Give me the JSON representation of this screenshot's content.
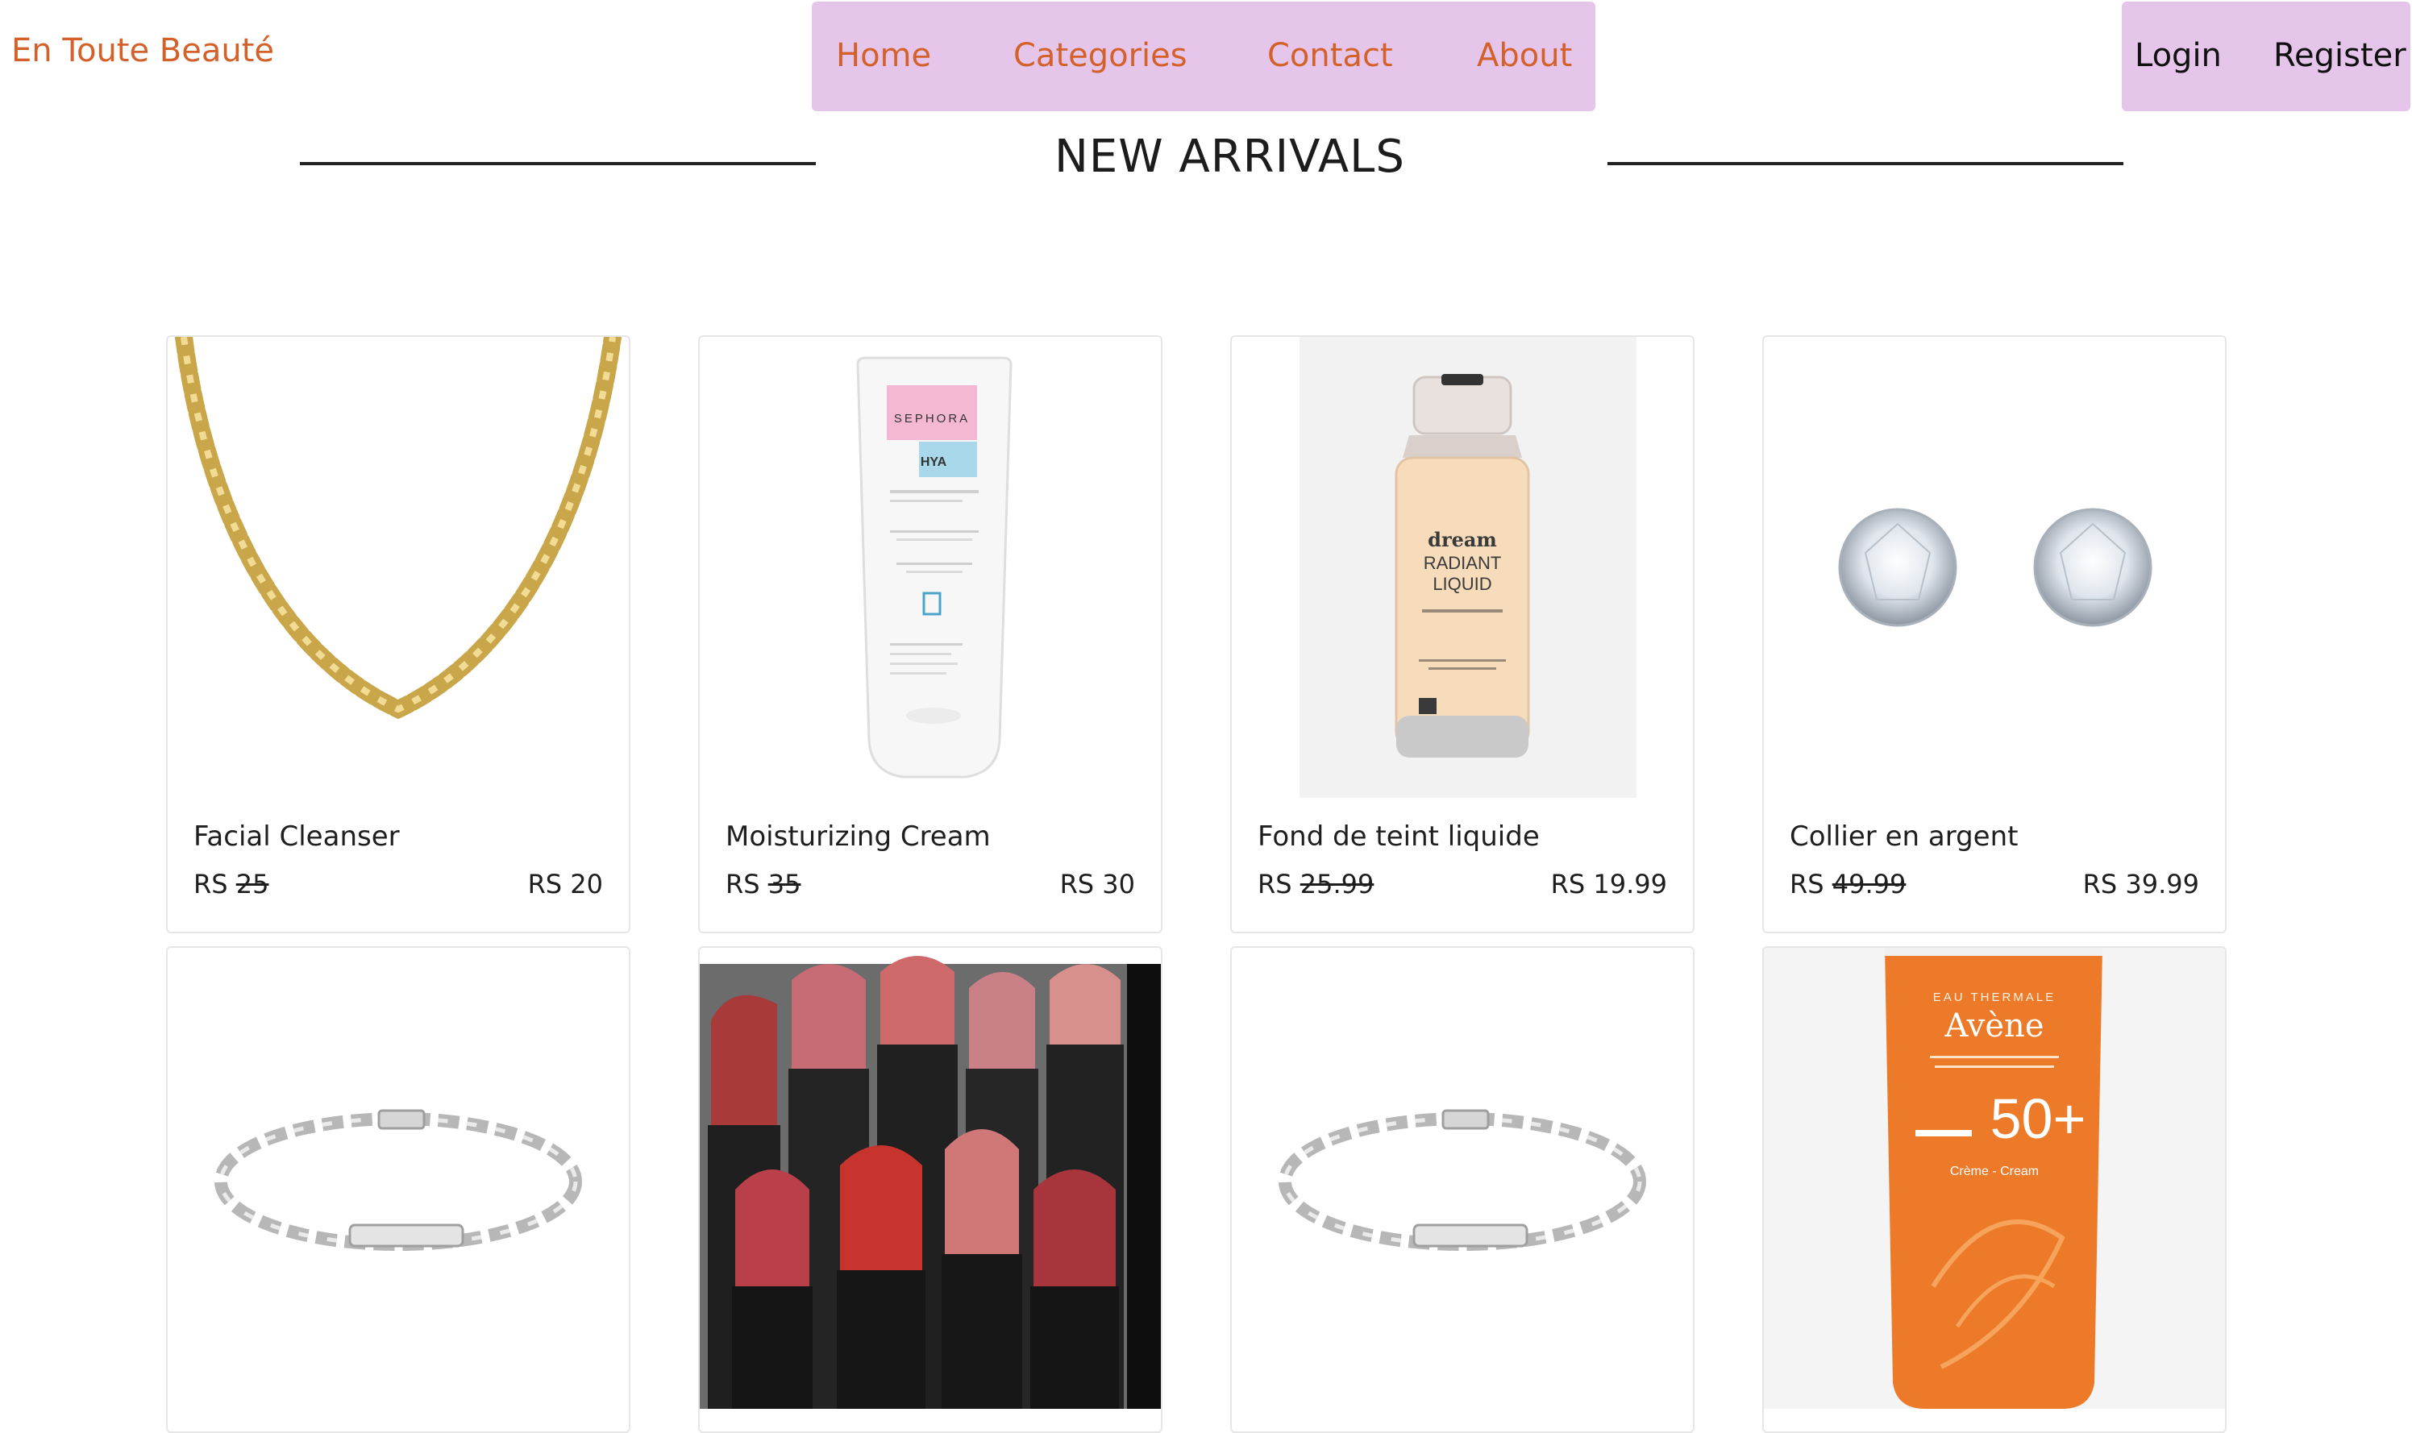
{
  "brand": "En Toute Beauté",
  "nav": {
    "home": "Home",
    "categories": "Categories",
    "contact": "Contact",
    "about": "About"
  },
  "auth": {
    "login": "Login",
    "register": "Register"
  },
  "section": {
    "title": "NEW ARRIVALS"
  },
  "currency": "RS",
  "products": [
    {
      "name": "Facial Cleanser",
      "old_price": "25",
      "price": "RS 20",
      "image": "gold-chain-necklace"
    },
    {
      "name": "Moisturizing Cream",
      "old_price": "35",
      "price": "RS 30",
      "image": "sephora-hya-tube"
    },
    {
      "name": "Fond de teint liquide",
      "old_price": "25.99",
      "price": "RS 19.99",
      "image": "maybelline-foundation-bottle"
    },
    {
      "name": "Collier en argent",
      "old_price": "49.99",
      "price": "RS 39.99",
      "image": "diamond-stud-earrings"
    },
    {
      "name": "",
      "old_price": "",
      "price": "",
      "image": "silver-id-bracelet"
    },
    {
      "name": "",
      "old_price": "",
      "price": "",
      "image": "lipsticks"
    },
    {
      "name": "",
      "old_price": "",
      "price": "",
      "image": "silver-id-bracelet"
    },
    {
      "name": "",
      "old_price": "",
      "price": "",
      "image": "avene-sunscreen-tube"
    }
  ],
  "product_images_text": {
    "sephora_brand": "SEPHORA",
    "sephora_hya": "HYA",
    "maybelline_line1": "dream",
    "maybelline_line2": "RADIANT",
    "maybelline_line3": "LIQUID",
    "avene_top": "EAU THERMALE",
    "avene_brand": "Avène",
    "avene_spf": "50+",
    "avene_sub": "Crème - Cream"
  },
  "colors": {
    "accent": "#d4602a",
    "nav_bg": "#e5c6ea"
  }
}
